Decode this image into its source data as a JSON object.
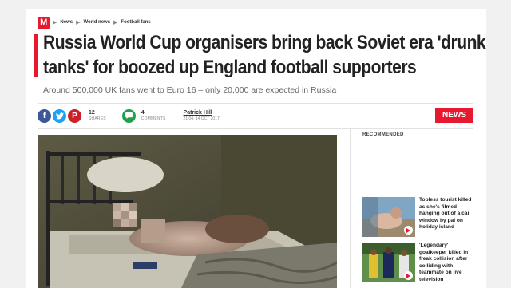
{
  "brand": {
    "logo_letter": "M",
    "accent": "#e6192e"
  },
  "breadcrumb": [
    "News",
    "World news",
    "Football fans"
  ],
  "headline": {
    "line1": "Russia World Cup organisers bring back Soviet era 'drunk",
    "line2": "tanks' for boozed up England football supporters"
  },
  "subheadline": "Around 500,000 UK fans went to Euro 16 – only 20,000 are expected in Russia",
  "share": {
    "icons": [
      "facebook-icon",
      "twitter-icon",
      "pinterest-icon"
    ],
    "count": "12",
    "count_label": "SHARES"
  },
  "comments": {
    "count": "4",
    "label": "COMMENTS"
  },
  "author": {
    "name": "Patrick Hill",
    "date": "21:04, 14 OCT 2017"
  },
  "section_badge": "NEWS",
  "sidebar": {
    "title": "RECOMMENDED",
    "items": [
      {
        "text": "Topless tourist killed as she's filmed hanging out of a car window by pal on holiday island"
      },
      {
        "text": "'Legendary' goalkeeper killed in freak collision after colliding with teammate on live television"
      }
    ]
  }
}
